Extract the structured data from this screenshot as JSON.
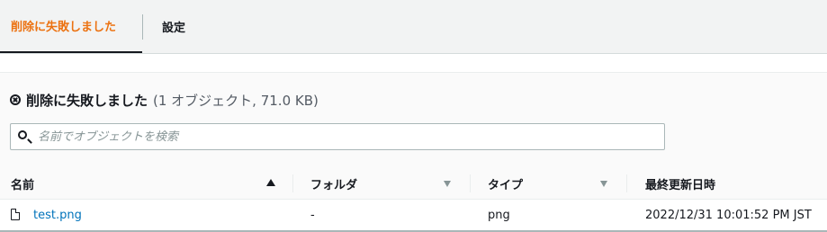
{
  "tabs": {
    "failed_label": "削除に失敗しました",
    "settings_label": "設定"
  },
  "header": {
    "title": "削除に失敗しました",
    "count": "(1 オブジェクト, 71.0 KB)"
  },
  "search": {
    "placeholder": "名前でオブジェクトを検索",
    "value": ""
  },
  "table": {
    "columns": [
      "名前",
      "フォルダ",
      "タイプ",
      "最終更新日時"
    ],
    "rows": [
      {
        "name": "test.png",
        "folder": "-",
        "type": "png",
        "modified": "2022/12/31 10:01:52 PM JST"
      }
    ]
  },
  "colors": {
    "accent": "#ec7211",
    "link": "#0073bb"
  },
  "icons": [
    "x-circle-icon",
    "search-icon",
    "sort-ascending-icon",
    "sort-icon",
    "file-icon"
  ]
}
